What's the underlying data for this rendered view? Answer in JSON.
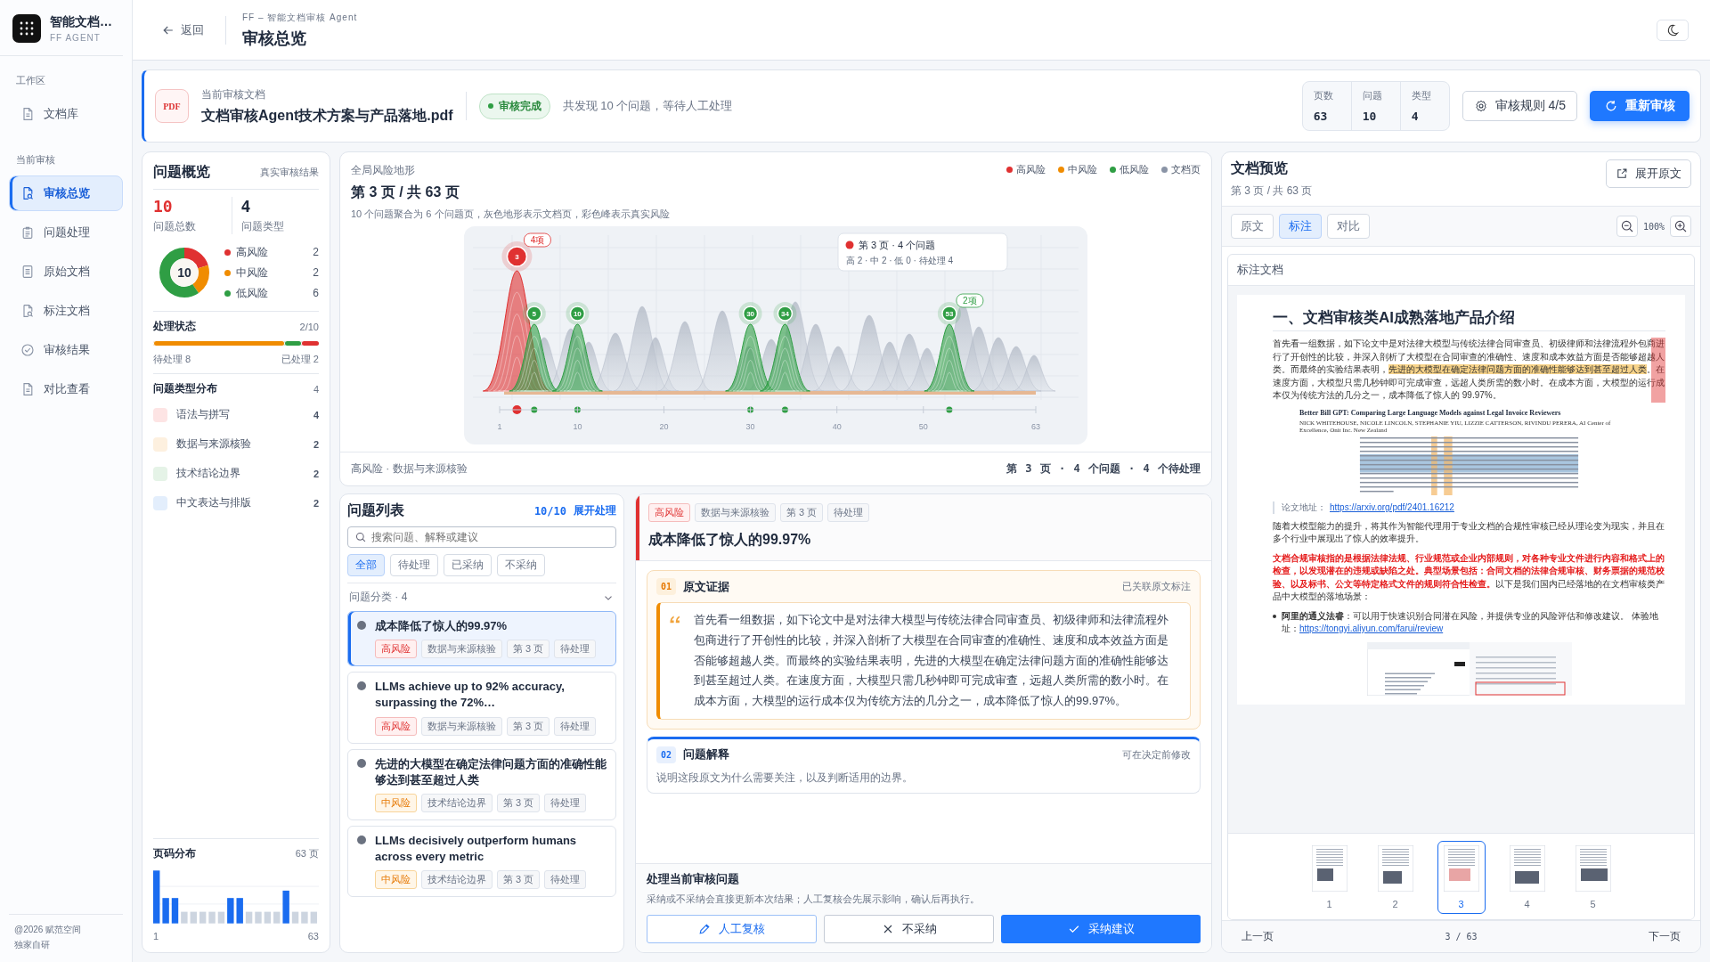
{
  "app": {
    "name": "智能文档…",
    "subtitle": "FF AGENT"
  },
  "sidebar": {
    "sections": [
      {
        "title": "工作区",
        "items": [
          {
            "label": "文档库",
            "selected": false
          }
        ]
      },
      {
        "title": "当前审核",
        "items": [
          {
            "label": "审核总览",
            "selected": true
          },
          {
            "label": "问题处理",
            "selected": false
          },
          {
            "label": "原始文档",
            "selected": false
          },
          {
            "label": "标注文档",
            "selected": false
          },
          {
            "label": "审核结果",
            "selected": false
          },
          {
            "label": "对比查看",
            "selected": false
          }
        ]
      }
    ],
    "footer": [
      "@2026 赋范空间",
      "独家自研"
    ]
  },
  "header": {
    "back": "返回",
    "breadcrumb": "FF – 智能文档审核 Agent",
    "title": "审核总览"
  },
  "document": {
    "badge": "PDF",
    "caption": "当前审核文档",
    "name": "文档审核Agent技术方案与产品落地.pdf",
    "status": "审核完成",
    "summary": "共发现 10 个问题，等待人工处理",
    "stats": [
      {
        "label": "页数",
        "value": "63"
      },
      {
        "label": "问题",
        "value": "10"
      },
      {
        "label": "类型",
        "value": "4"
      }
    ],
    "rules_button": "审核规则 4/5",
    "rerun_button": "重新审核"
  },
  "overview": {
    "title": "问题概览",
    "note": "真实审核结果",
    "totals": [
      {
        "value": "10",
        "label": "问题总数",
        "kind": "alert"
      },
      {
        "value": "4",
        "label": "问题类型",
        "kind": "plain"
      }
    ],
    "donut_center": "10",
    "risks": [
      {
        "label": "高风险",
        "count": "2",
        "color": "#e03131"
      },
      {
        "label": "中风险",
        "count": "2",
        "color": "#f08c00"
      },
      {
        "label": "低风险",
        "count": "6",
        "color": "#2f9e44"
      }
    ],
    "status": {
      "title": "处理状态",
      "ratio": "2/10",
      "level": 0.79,
      "processed_segments": [
        {
          "color": "#2f9e44"
        },
        {
          "color": "#e03131"
        }
      ],
      "pending": "待处理 8",
      "done": "已处理 2"
    },
    "types": {
      "title": "问题类型分布",
      "count": "4",
      "items": [
        {
          "label": "语法与拼写",
          "count": "4",
          "color": "#fde4e4"
        },
        {
          "label": "数据与来源核验",
          "count": "2",
          "color": "#fdf0df"
        },
        {
          "label": "技术结论边界",
          "count": "2",
          "color": "#e5f3e7"
        },
        {
          "label": "中文表达与排版",
          "count": "2",
          "color": "#e3eefc"
        }
      ]
    },
    "pages": {
      "title": "页码分布",
      "count": "63 页",
      "start": "1",
      "end": "63"
    }
  },
  "terrain": {
    "kicker": "全局风险地形",
    "title": "第 3 页 / 共 63 页",
    "subtitle": "10 个问题聚合为 6 个问题页，灰色地形表示文档页，彩色峰表示真实风险",
    "legend": [
      {
        "label": "高风险",
        "color": "#e03131"
      },
      {
        "label": "中风险",
        "color": "#f08c00"
      },
      {
        "label": "低风险",
        "color": "#2f9e44"
      },
      {
        "label": "文档页",
        "color": "#8a94a6"
      }
    ],
    "markers": [
      {
        "page": "3",
        "color": "#e03131",
        "selected": true,
        "badge": "4项"
      },
      {
        "page": "5",
        "color": "#2f9e44",
        "selected": false
      },
      {
        "page": "10",
        "color": "#2f9e44",
        "selected": false
      },
      {
        "page": "30",
        "color": "#2f9e44",
        "selected": false
      },
      {
        "page": "34",
        "color": "#2f9e44",
        "selected": false
      },
      {
        "page": "53",
        "color": "#2f9e44",
        "selected": false,
        "badge": "2项"
      }
    ],
    "xticks": [
      "1",
      "10",
      "20",
      "30",
      "40",
      "50",
      "63"
    ],
    "tooltip": {
      "title": "第 3 页 · 4 个问题",
      "detail": "高 2 · 中 2 · 低 0 · 待处理 4"
    },
    "footer_left": "高风险 · 数据与来源核验",
    "footer_right": "第 3 页 · 4 个问题 · 4 个待处理"
  },
  "issues": {
    "title": "问题列表",
    "count": "10/10",
    "expand": "展开处理",
    "search_placeholder": "搜索问题、解释或建议",
    "filters": [
      {
        "label": "全部",
        "selected": true
      },
      {
        "label": "待处理",
        "selected": false
      },
      {
        "label": "已采纳",
        "selected": false
      },
      {
        "label": "不采纳",
        "selected": false
      }
    ],
    "category": "问题分类 · 4",
    "items": [
      {
        "title": "成本降低了惊人的99.97%",
        "selected": true,
        "tags": [
          {
            "label": "高风险",
            "kind": "high"
          },
          {
            "label": "数据与来源核验",
            "kind": "plain"
          },
          {
            "label": "第 3 页",
            "kind": "plain"
          },
          {
            "label": "待处理",
            "kind": "plain"
          }
        ]
      },
      {
        "title": "LLMs achieve up to 92% accuracy, surpassing the 72%…",
        "selected": false,
        "tags": [
          {
            "label": "高风险",
            "kind": "high"
          },
          {
            "label": "数据与来源核验",
            "kind": "plain"
          },
          {
            "label": "第 3 页",
            "kind": "plain"
          },
          {
            "label": "待处理",
            "kind": "plain"
          }
        ]
      },
      {
        "title": "先进的大模型在确定法律问题方面的准确性能够达到甚至超过人类",
        "selected": false,
        "tags": [
          {
            "label": "中风险",
            "kind": "medium"
          },
          {
            "label": "技术结论边界",
            "kind": "plain"
          },
          {
            "label": "第 3 页",
            "kind": "plain"
          },
          {
            "label": "待处理",
            "kind": "plain"
          }
        ]
      },
      {
        "title": "LLMs decisively outperform humans across every metric",
        "selected": false,
        "tags": [
          {
            "label": "中风险",
            "kind": "medium"
          },
          {
            "label": "技术结论边界",
            "kind": "plain"
          },
          {
            "label": "第 3 页",
            "kind": "plain"
          },
          {
            "label": "待处理",
            "kind": "plain"
          }
        ]
      }
    ]
  },
  "detail": {
    "tags": [
      {
        "label": "高风险",
        "kind": "high"
      },
      {
        "label": "数据与来源核验",
        "kind": "plain"
      },
      {
        "label": "第 3 页",
        "kind": "plain"
      },
      {
        "label": "待处理",
        "kind": "plain"
      }
    ],
    "title": "成本降低了惊人的99.97%",
    "evidence": {
      "index": "01",
      "title": "原文证据",
      "note": "已关联原文标注",
      "quote": "首先看一组数据，如下论文中是对法律大模型与传统法律合同审查员、初级律师和法律流程外包商进行了开创性的比较，并深入剖析了大模型在合同审查的准确性、速度和成本效益方面是否能够超越人类。而最终的实验结果表明，先进的大模型在确定法律问题方面的准确性能够达到甚至超过人类。在速度方面，大模型只需几秒钟即可完成审查，远超人类所需的数小时。在成本方面，大模型的运行成本仅为传统方法的几分之一，成本降低了惊人的99.97%。"
    },
    "explanation": {
      "index": "02",
      "title": "问题解释",
      "note": "可在决定前修改",
      "text": "说明这段原文为什么需要关注，以及判断适用的边界。"
    },
    "action": {
      "title": "处理当前审核问题",
      "text": "采纳或不采纳会直接更新本次结果；人工复核会先展示影响，确认后再执行。",
      "buttons": [
        {
          "label": "人工复核",
          "kind": "review"
        },
        {
          "label": "不采纳",
          "kind": "reject"
        },
        {
          "label": "采纳建议",
          "kind": "accept"
        }
      ]
    }
  },
  "preview": {
    "title": "文档预览",
    "page": "第 3 页 / 共 63 页",
    "expand": "展开原文",
    "modes": [
      {
        "label": "原文",
        "selected": false
      },
      {
        "label": "标注",
        "selected": true
      },
      {
        "label": "对比",
        "selected": false
      }
    ],
    "zoom": "100%",
    "panel_title": "标注文档",
    "doc": {
      "heading": "一、文档审核类AI成熟落地产品介绍",
      "para1": [
        {
          "text": "首先看一组数据，如下论文中是对法律大模型与传统法律合同审查员、初级律师和法律流程外包商进行了开创性的比较，并深入剖析了大模型在合同审查的准确性、速度和成本效益方面是否能够超越人类。而最终的实验结果表明，",
          "highlight": false
        },
        {
          "text": "先进的大模型在确定法律问题方面的准确性能够达到甚至超过人类",
          "highlight": true
        },
        {
          "text": "。在速度方面，大模型只需几秒钟即可完成审查，远超人类所需的数小时。在成本方面，大模型的运行成本仅为传统方法的几分之一，成本降低了惊人的 99.97%。",
          "highlight": false
        }
      ],
      "paper_title": "Better Bill GPT: Comparing Large Language Models against Legal Invoice Reviewers",
      "paper_authors": "NICK WHITEHOUSE, NICOLE LINCOLN, STEPHANIE YIU, LIZZIE CATTERSON, RIVINDU PERERA, AI Center of Excellence, Onit Inc. New Zealand",
      "link_label": "论文地址：",
      "link": "https://arxiv.org/pdf/2401.16212",
      "para2": "随着大模型能力的提升，将其作为智能代理用于专业文档的合规性审核已经从理论变为现实，并且在多个行业中展现出了惊人的效率提升。",
      "para3": [
        {
          "text": "文档合规审核指的是根据法律法规、行业规范或企业内部规则，对各种专业文件进行内容和格式上的检查，以发现潜在的违规或缺陷之处。典型场景包括：合同文档的法律合规审核、财务票据的规范校验、以及标书、公文等特定格式文件的规则符合性检查。",
          "kind": "emphasis"
        },
        {
          "text": "以下是我们国内已经落地的在文档审核类产品中大模型的落地场景：",
          "kind": "normal"
        }
      ],
      "bullet": "**阿里的通义法睿**：可以用于快速识别合同潜在风险，并提供专业的风险评估和修改建议。 体验地址：",
      "bullet_link": "https://tongyi.aliyun.com/farui/review"
    },
    "thumbnails": [
      {
        "label": "1",
        "selected": false
      },
      {
        "label": "2",
        "selected": false
      },
      {
        "label": "3",
        "selected": true
      },
      {
        "label": "4",
        "selected": false
      },
      {
        "label": "5",
        "selected": false
      }
    ],
    "prev": "上一页",
    "pager": "3 / 63",
    "next": "下一页"
  }
}
